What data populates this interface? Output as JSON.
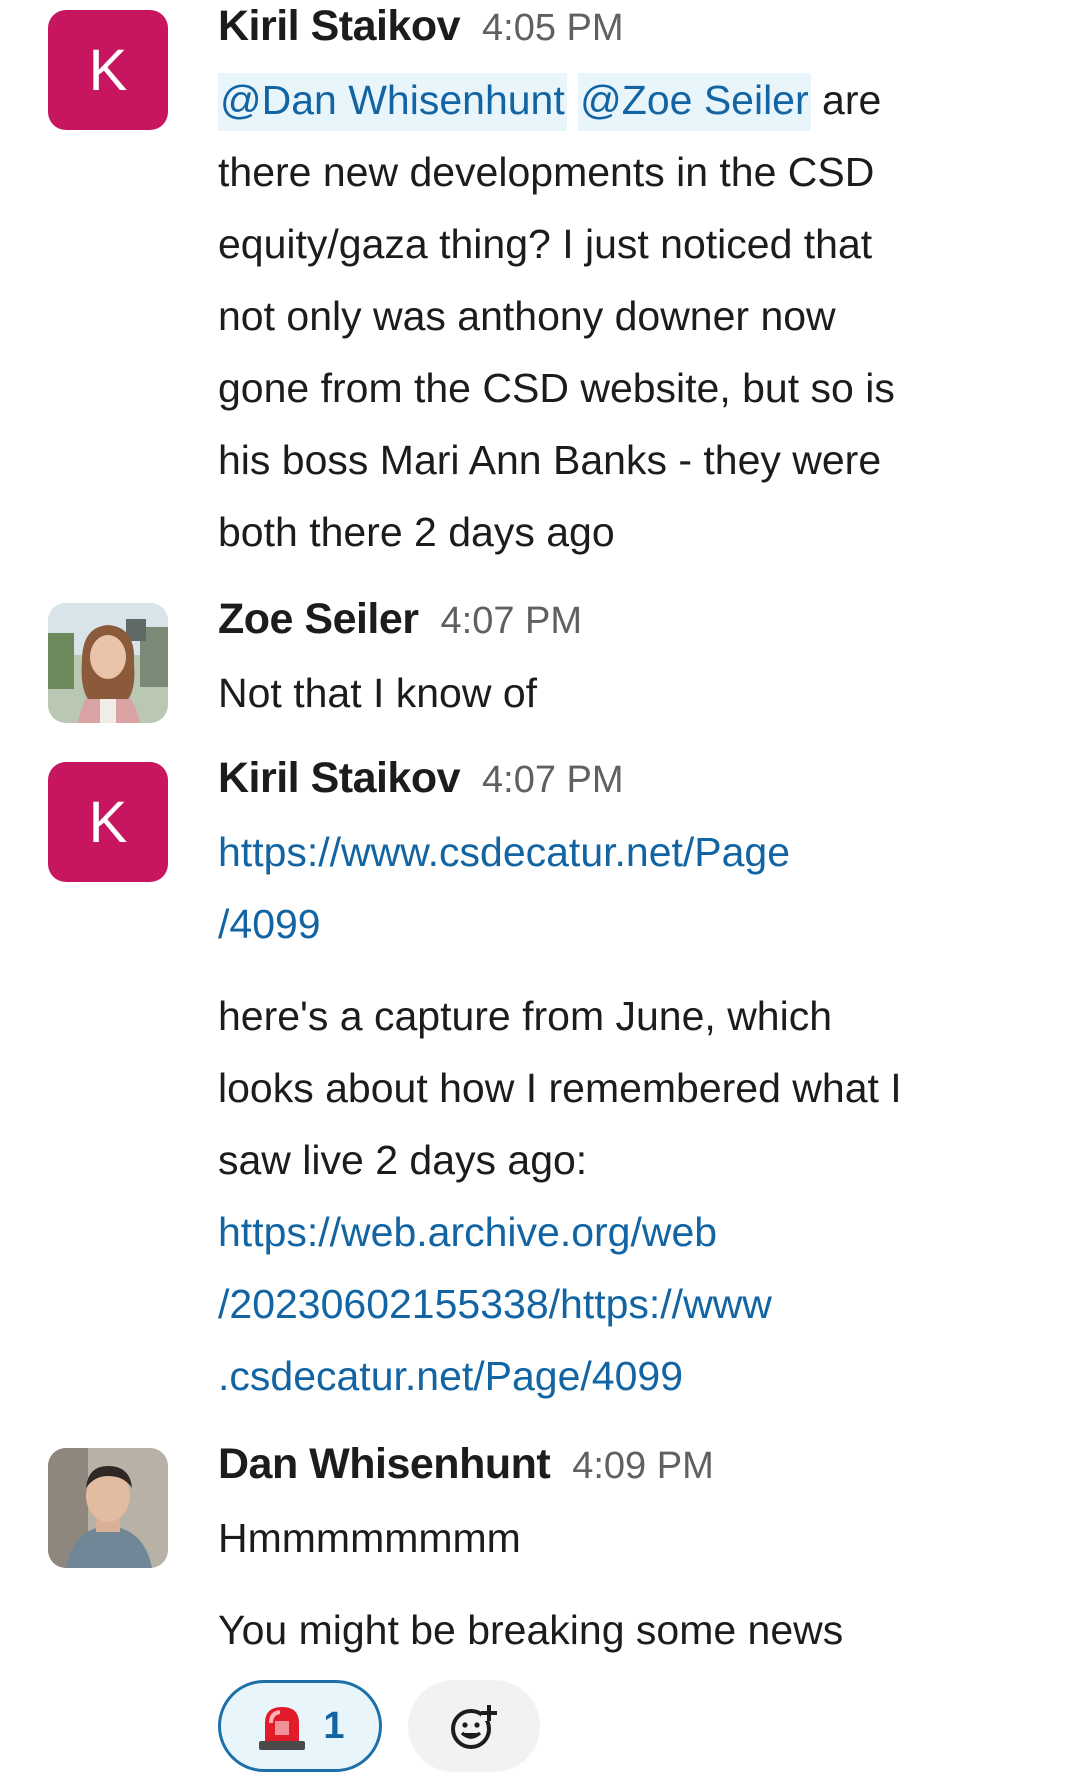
{
  "messages": [
    {
      "author": "Kiril Staikov",
      "time": "4:05 PM",
      "avatar_letter": "K",
      "mention_1": "@Dan Whisenhunt",
      "mention_2": "@Zoe Seiler",
      "lines": [
        "are",
        "there new developments in the CSD",
        "equity/gaza thing? I just noticed that",
        "not only was anthony downer now",
        "gone from  the CSD website, but so is",
        "his boss Mari Ann Banks - they were",
        "both there 2 days ago"
      ]
    },
    {
      "author": "Zoe Seiler",
      "time": "4:07 PM",
      "lines": [
        "Not that I know of"
      ]
    },
    {
      "author": "Kiril Staikov",
      "time": "4:07 PM",
      "avatar_letter": "K",
      "link_1": [
        "https://www.csdecatur.net/Page",
        "/4099"
      ],
      "lines": [
        "here's a capture from June, which",
        "looks about how I remembered what I",
        "saw live 2 days ago:"
      ],
      "link_2": [
        "https://web.archive.org/web",
        "/20230602155338/https://www",
        ".csdecatur.net/Page/4099"
      ]
    },
    {
      "author": "Dan Whisenhunt",
      "time": "4:09 PM",
      "lines": [
        "Hmmmmmmmm",
        "You might be breaking some news"
      ],
      "reaction": {
        "emoji": "rotating-light",
        "count": "1"
      },
      "add_reaction_icon": "add-reaction-icon"
    }
  ],
  "colors": {
    "avatar_k": "#c7165f",
    "link": "#1264a3",
    "mention_bg": "#e8f5fa"
  }
}
